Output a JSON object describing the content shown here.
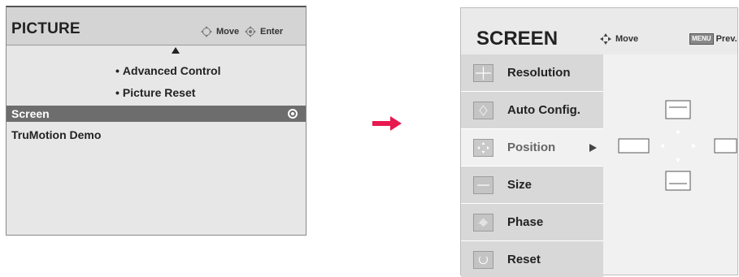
{
  "picture_menu": {
    "title": "PICTURE",
    "hint_move": "Move",
    "hint_enter": "Enter",
    "submenu": [
      {
        "bullet": "•",
        "label": "Advanced Control"
      },
      {
        "bullet": "•",
        "label": "Picture Reset"
      }
    ],
    "rows": [
      {
        "label": "Screen",
        "selected": true
      },
      {
        "label": "TruMotion Demo",
        "selected": false
      }
    ]
  },
  "screen_menu": {
    "title": "SCREEN",
    "hint_move": "Move",
    "menu_key": "MENU",
    "hint_prev": "Prev.",
    "items": [
      {
        "label": "Resolution",
        "icon": "resolution-icon"
      },
      {
        "label": "Auto Config.",
        "icon": "auto-config-icon"
      },
      {
        "label": "Position",
        "icon": "position-icon",
        "active": true
      },
      {
        "label": "Size",
        "icon": "size-icon"
      },
      {
        "label": "Phase",
        "icon": "phase-icon"
      },
      {
        "label": "Reset",
        "icon": "reset-icon"
      }
    ]
  },
  "colors": {
    "arrow": "#e8194f",
    "selected_row": "#6d6d6d",
    "panel_bg": "#e7e7e7"
  }
}
